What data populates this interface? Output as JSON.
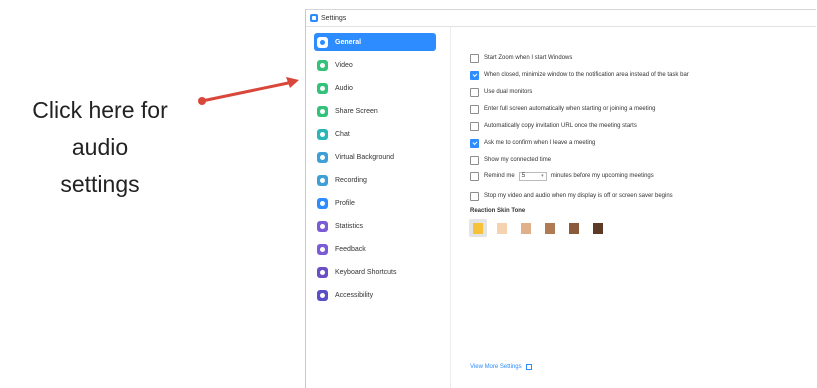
{
  "annotation": {
    "lines": [
      "Click here for",
      "audio",
      "settings"
    ]
  },
  "window": {
    "title": "Settings"
  },
  "sidebar": {
    "items": [
      {
        "label": "General",
        "icon": "gear-icon",
        "color": "#2d8cff",
        "active": true
      },
      {
        "label": "Video",
        "icon": "video-icon",
        "color": "#34c27a"
      },
      {
        "label": "Audio",
        "icon": "headphones-icon",
        "color": "#34c27a"
      },
      {
        "label": "Share Screen",
        "icon": "share-screen-icon",
        "color": "#34c27a"
      },
      {
        "label": "Chat",
        "icon": "chat-icon",
        "color": "#2ab6b6"
      },
      {
        "label": "Virtual Background",
        "icon": "virtual-background-icon",
        "color": "#3fa0d8"
      },
      {
        "label": "Recording",
        "icon": "recording-icon",
        "color": "#3fa0d8"
      },
      {
        "label": "Profile",
        "icon": "profile-icon",
        "color": "#2d8cff"
      },
      {
        "label": "Statistics",
        "icon": "statistics-icon",
        "color": "#7b5cd6"
      },
      {
        "label": "Feedback",
        "icon": "feedback-icon",
        "color": "#7b5cd6"
      },
      {
        "label": "Keyboard Shortcuts",
        "icon": "keyboard-icon",
        "color": "#6a4fc7"
      },
      {
        "label": "Accessibility",
        "icon": "accessibility-icon",
        "color": "#5b4fc7"
      }
    ]
  },
  "general": {
    "options": [
      {
        "label": "Start Zoom when I start Windows",
        "checked": false
      },
      {
        "label": "When closed, minimize window to the notification area instead of the task bar",
        "checked": true
      },
      {
        "label": "Use dual monitors",
        "checked": false
      },
      {
        "label": "Enter full screen automatically when starting or joining a meeting",
        "checked": false
      },
      {
        "label": "Automatically copy invitation URL once the meeting starts",
        "checked": false
      },
      {
        "label": "Ask me to confirm when I leave a meeting",
        "checked": true
      },
      {
        "label": "Show my connected time",
        "checked": false
      }
    ],
    "reminder": {
      "prefix": "Remind me",
      "value": "5",
      "suffix": "minutes before my upcoming meetings",
      "checked": false
    },
    "stop_video": {
      "label": "Stop my video and audio when my display is off or screen saver begins",
      "checked": false
    },
    "reaction_title": "Reaction Skin Tone",
    "skin_tones": [
      "#f7c23a",
      "#f5d3b1",
      "#e0b08a",
      "#b07a52",
      "#8a5a3b",
      "#5c3a26"
    ],
    "selected_tone": 0,
    "view_more": "View More Settings"
  },
  "colors": {
    "accent": "#2d8cff",
    "arrow": "#d9473a"
  }
}
